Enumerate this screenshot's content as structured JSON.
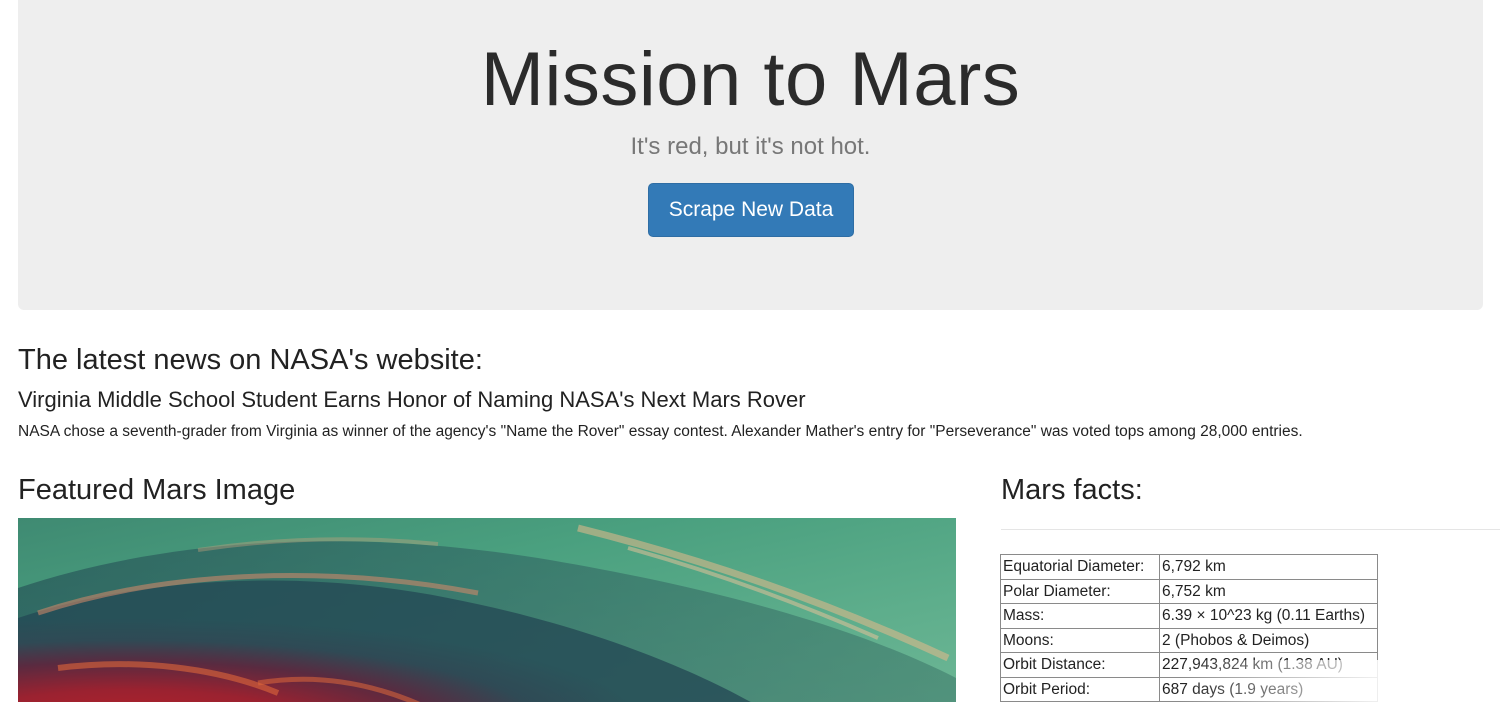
{
  "header": {
    "title": "Mission to Mars",
    "tagline": "It's red, but it's not hot.",
    "scrape_button_label": "Scrape New Data"
  },
  "news": {
    "heading": "The latest news on NASA's website:",
    "title": "Virginia Middle School Student Earns Honor of Naming NASA's Next Mars Rover",
    "teaser": "NASA chose a seventh-grader from Virginia as winner of the agency's \"Name the Rover\" essay contest. Alexander Mather's entry for \"Perseverance\" was voted tops among 28,000 entries."
  },
  "featured_image": {
    "heading": "Featured Mars Image"
  },
  "facts": {
    "heading": "Mars facts:",
    "rows": [
      {
        "label": "Equatorial Diameter:",
        "value": "6,792 km"
      },
      {
        "label": "Polar Diameter:",
        "value": "6,752 km"
      },
      {
        "label": "Mass:",
        "value": "6.39 × 10^23 kg (0.11 Earths)"
      },
      {
        "label": "Moons:",
        "value": "2 (Phobos & Deimos)"
      },
      {
        "label": "Orbit Distance:",
        "value": "227,943,824 km (1.38 AU)"
      },
      {
        "label": "Orbit Period:",
        "value": "687 days (1.9 years)"
      }
    ]
  },
  "colors": {
    "jumbotron_bg": "#eeeeee",
    "button_primary": "#337ab7"
  }
}
